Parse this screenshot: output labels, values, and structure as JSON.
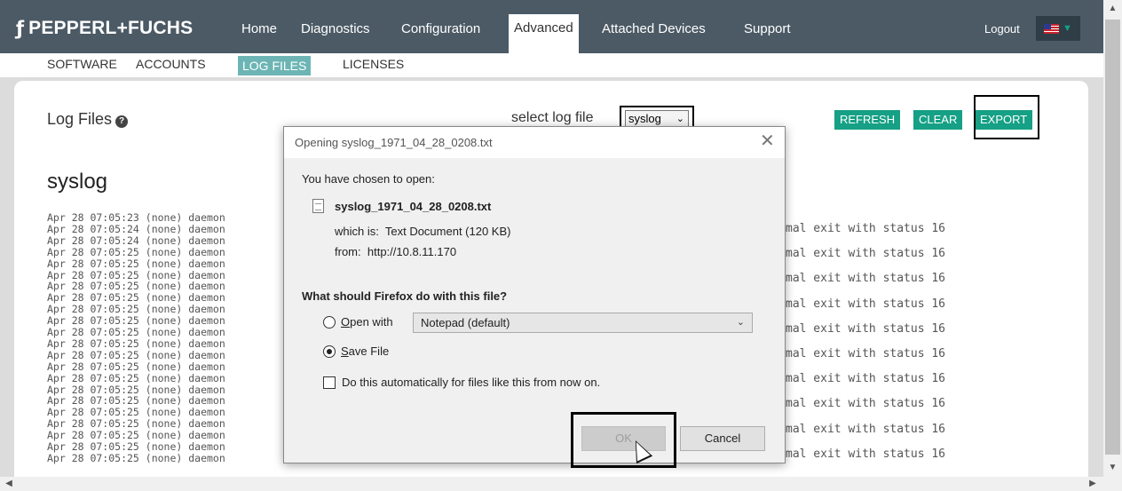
{
  "brand": {
    "mark": "ƒ",
    "name": "PEPPERL+FUCHS"
  },
  "nav": {
    "items": [
      "Home",
      "Diagnostics",
      "Configuration",
      "Advanced",
      "Attached Devices",
      "Support"
    ],
    "active": "Advanced",
    "logout": "Logout"
  },
  "subnav": {
    "items": [
      "SOFTWARE",
      "ACCOUNTS",
      "LOG FILES",
      "LICENSES"
    ],
    "active": "LOG FILES"
  },
  "page": {
    "title": "Log Files",
    "help_icon": "question-icon",
    "select_label": "select log file",
    "select_value": "syslog",
    "buttons": {
      "refresh": "REFRESH",
      "clear": "CLEAR",
      "export": "EXPORT"
    },
    "log_heading": "syslog",
    "log_prefixes": [
      "Apr 28 07:05:23 (none) daemon",
      "Apr 28 07:05:24 (none) daemon",
      "Apr 28 07:05:24 (none) daemon",
      "Apr 28 07:05:25 (none) daemon",
      "Apr 28 07:05:25 (none) daemon",
      "Apr 28 07:05:25 (none) daemon",
      "Apr 28 07:05:25 (none) daemon",
      "Apr 28 07:05:25 (none) daemon",
      "Apr 28 07:05:25 (none) daemon",
      "Apr 28 07:05:25 (none) daemon",
      "Apr 28 07:05:25 (none) daemon",
      "Apr 28 07:05:25 (none) daemon",
      "Apr 28 07:05:25 (none) daemon",
      "Apr 28 07:05:25 (none) daemon",
      "Apr 28 07:05:25 (none) daemon",
      "Apr 28 07:05:25 (none) daemon",
      "Apr 28 07:05:25 (none) daemon",
      "Apr 28 07:05:25 (none) daemon",
      "Apr 28 07:05:25 (none) daemon",
      "Apr 28 07:05:25 (none) daemon",
      "Apr 28 07:05:25 (none) daemon",
      "Apr 28 07:05:25 (none) daemon"
    ],
    "log_suffix": "mal exit with status 16"
  },
  "dialog": {
    "title": "Opening syslog_1971_04_28_0208.txt",
    "intro": "You have chosen to open:",
    "filename": "syslog_1971_04_28_0208.txt",
    "which_is_label": "which is:",
    "which_is_value": "Text Document (120 KB)",
    "from_label": "from:",
    "from_value": "http://10.8.11.170",
    "question": "What should Firefox do with this file?",
    "open_with_label": "Open with",
    "open_with_app": "Notepad (default)",
    "save_file_label": "Save File",
    "selected_option": "save",
    "auto_label": "Do this automatically for files like this from now on.",
    "auto_checked": false,
    "ok": "OK",
    "cancel": "Cancel"
  }
}
